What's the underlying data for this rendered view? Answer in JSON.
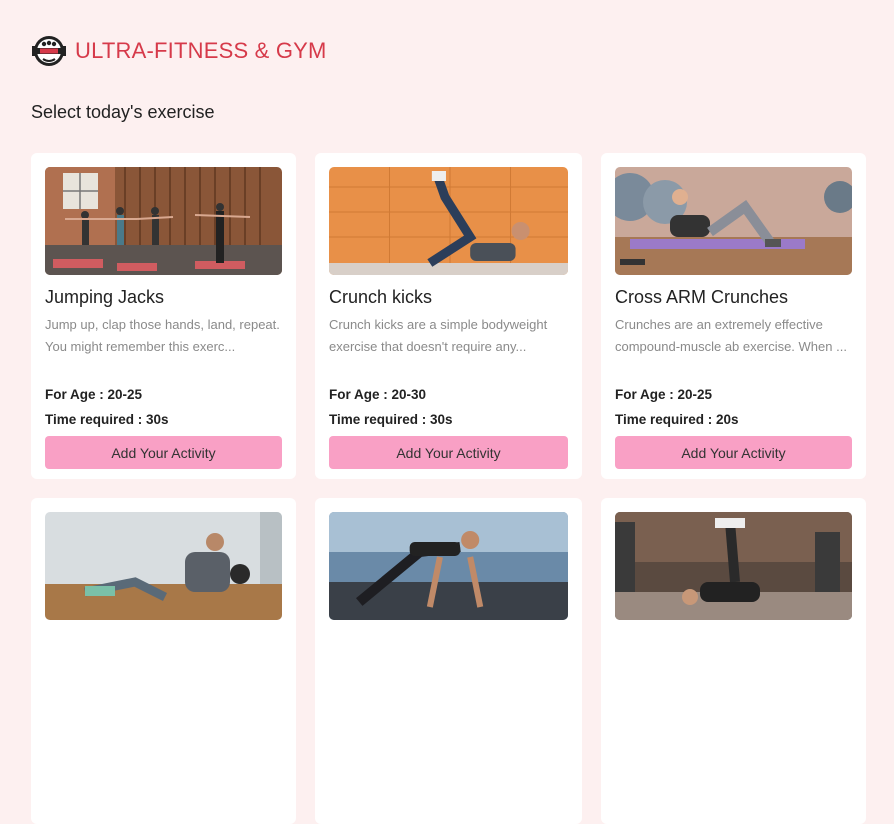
{
  "brand": {
    "name": "ULTRA-FITNESS & GYM",
    "logo_icon": "gym-logo-icon"
  },
  "page": {
    "subtitle": "Select today's exercise"
  },
  "exercises": [
    {
      "title": "Jumping Jacks",
      "description": "Jump up, clap those hands, land, repeat. You might remember this exerc...",
      "age": "For Age : 20-25",
      "time": "Time required : 30s",
      "button": "Add Your Activity"
    },
    {
      "title": "Crunch kicks",
      "description": "Crunch kicks are a simple bodyweight exercise that doesn't require any...",
      "age": "For Age : 20-30",
      "time": "Time required : 30s",
      "button": "Add Your Activity"
    },
    {
      "title": "Cross ARM Crunches",
      "description": "Crunches are an extremely effective compound-muscle ab exercise. When ...",
      "age": "For Age : 20-25",
      "time": "Time required : 20s",
      "button": "Add Your Activity"
    },
    {
      "image": "russian-twist-photo"
    },
    {
      "image": "mountain-climber-photo"
    },
    {
      "image": "leg-raise-photo"
    }
  ],
  "colors": {
    "background": "#fdf0f0",
    "brand": "#d63a4a",
    "button": "#f9a0c5"
  }
}
